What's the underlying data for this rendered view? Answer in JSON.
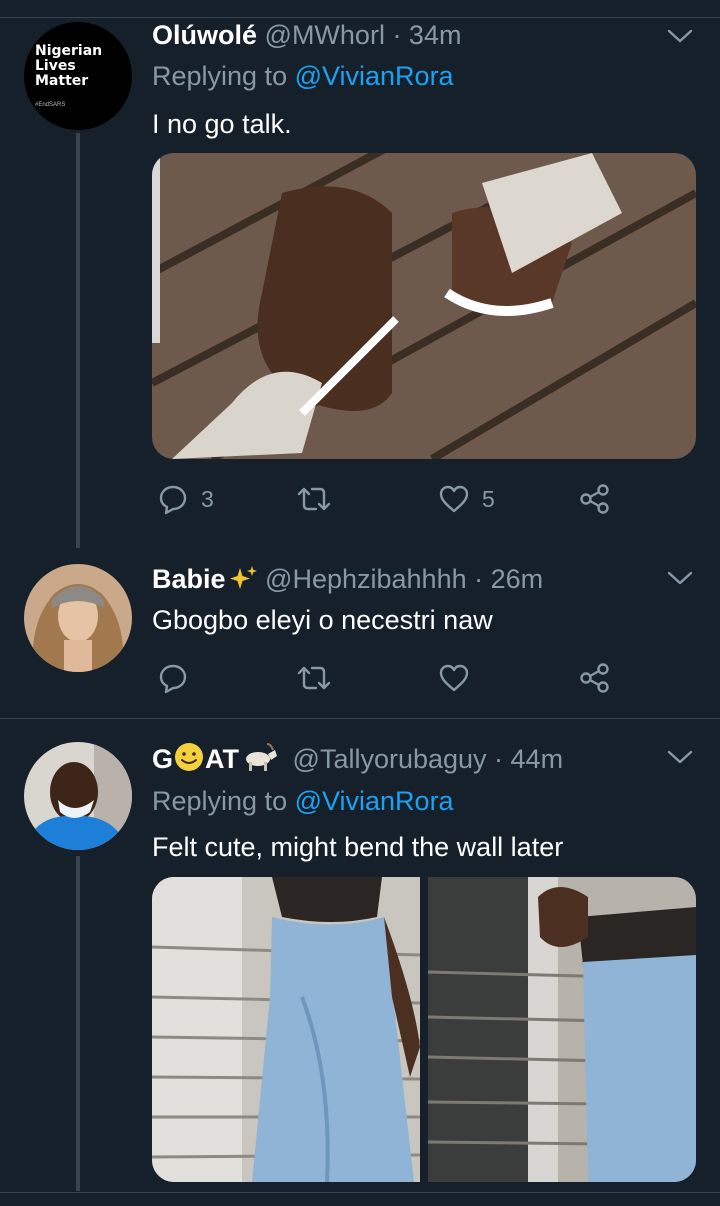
{
  "tweets": [
    {
      "avatar_text": [
        "Nigerian",
        "Lives",
        "Matter"
      ],
      "avatar_small": "#EndSARS",
      "name": "Olúwolé",
      "handle": "@MWhorl · 34m",
      "replying_label": "Replying to ",
      "replying_to": "@VivianRora",
      "text": "I no go talk.",
      "replies": "3",
      "likes": "5"
    },
    {
      "name": "Babie",
      "handle": "@Hephzibahhhh · 26m",
      "text": "Gbogbo eleyi o necestri naw"
    },
    {
      "name_prefix": "G",
      "name_suffix": "AT",
      "handle": "@Tallyorubaguy · 44m",
      "replying_label": "Replying to ",
      "replying_to": "@VivianRora",
      "text": "Felt cute, might bend the wall later"
    }
  ],
  "colors": {
    "background": "#15202b",
    "divider": "#38444d",
    "muted": "#8899a6",
    "link": "#1da1f2"
  }
}
